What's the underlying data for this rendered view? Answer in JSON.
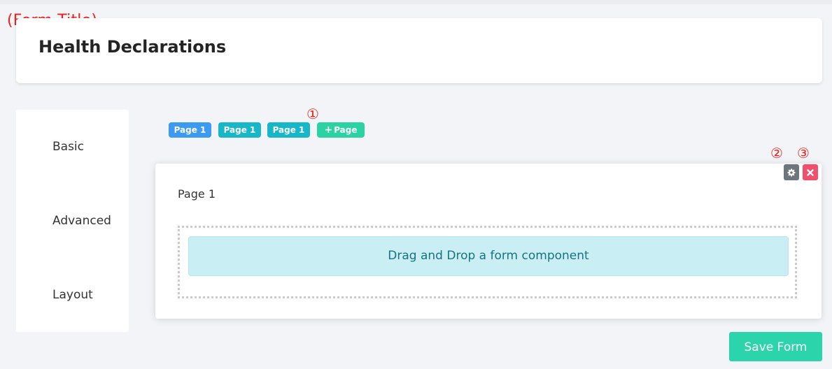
{
  "annotations": {
    "form_title_label": "(Form Title)",
    "marker_1": "①",
    "marker_2": "②",
    "marker_3": "③"
  },
  "form": {
    "title": "Health Declarations"
  },
  "sidebar": {
    "items": [
      {
        "label": "Basic"
      },
      {
        "label": "Advanced"
      },
      {
        "label": "Layout"
      }
    ]
  },
  "page_tabs": [
    {
      "label": "Page 1",
      "color": "#3c9bf0"
    },
    {
      "label": "Page 1",
      "color": "#17b7c8"
    },
    {
      "label": "Page 1",
      "color": "#17b7c8"
    }
  ],
  "add_page": {
    "plus": "+",
    "label": "Page",
    "color": "#2bd2a4"
  },
  "panel": {
    "title": "Page 1",
    "dropzone_message": "Drag and Drop a form component",
    "gear_icon": "gear-icon",
    "close_icon": "close-icon"
  },
  "save_button": {
    "label": "Save Form",
    "color": "#2cd4ab"
  },
  "colors": {
    "background": "#f3f4f8",
    "annotation_red": "#e8231f",
    "close_red": "#f0506e",
    "gear_gray": "#6f757c"
  }
}
